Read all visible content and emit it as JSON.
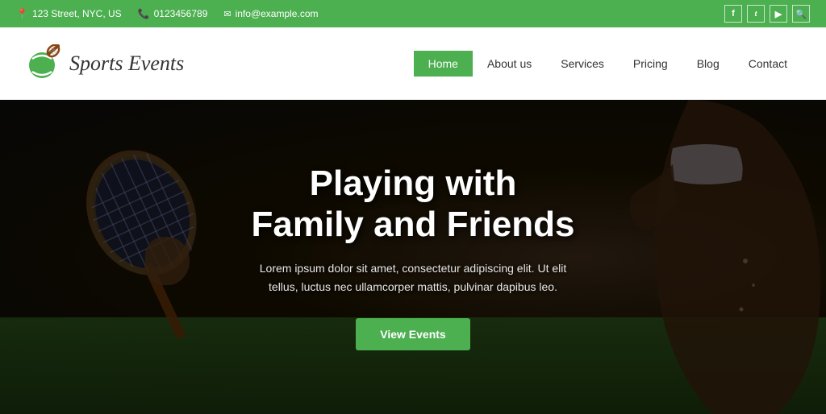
{
  "topbar": {
    "address": "123 Street, NYC, US",
    "phone": "0123456789",
    "email": "info@example.com",
    "address_icon": "📍",
    "phone_icon": "📞",
    "email_icon": "✉"
  },
  "social": {
    "facebook": "f",
    "twitter": "t",
    "youtube": "▶",
    "search": "🔍"
  },
  "header": {
    "logo_text": "Sports Events",
    "nav_items": [
      {
        "label": "Home",
        "active": true
      },
      {
        "label": "About us",
        "active": false
      },
      {
        "label": "Services",
        "active": false
      },
      {
        "label": "Pricing",
        "active": false
      },
      {
        "label": "Blog",
        "active": false
      },
      {
        "label": "Contact",
        "active": false
      }
    ]
  },
  "hero": {
    "title": "Playing with\nFamily and Friends",
    "subtitle": "Lorem ipsum dolor sit amet, consectetur adipiscing elit. Ut elit tellus, luctus nec ullamcorper mattis, pulvinar dapibus leo.",
    "button_label": "View Events"
  },
  "colors": {
    "green": "#4caf50",
    "dark": "#1a1a1a",
    "white": "#ffffff"
  }
}
